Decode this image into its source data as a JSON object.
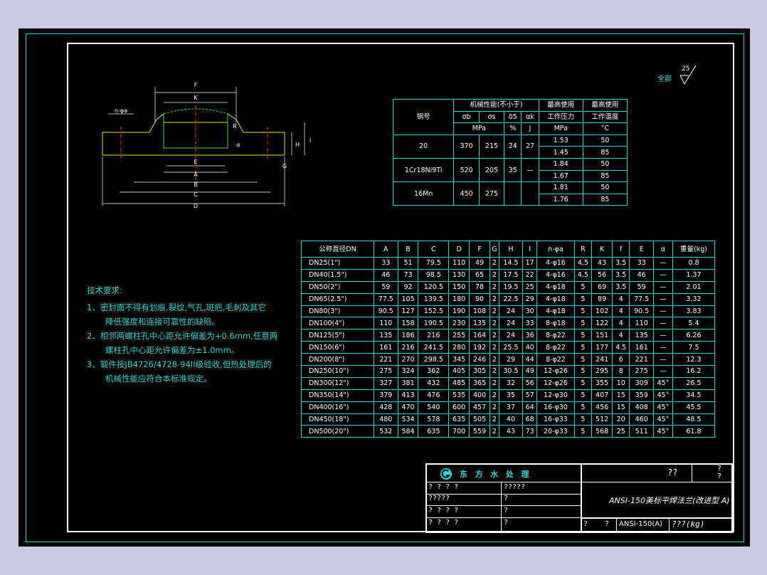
{
  "roughness": {
    "label": "全部",
    "value": "25"
  },
  "mech_table": {
    "header": {
      "grade": "钢号",
      "mech_props": "机械性能(不小于)",
      "sb": "σb",
      "ss": "σs",
      "d5": "δ5",
      "ak": "αk",
      "unit_mpa": "MPa",
      "unit_pct": "%",
      "unit_j": "J",
      "max_pressure": [
        "最高使用",
        "工作压力",
        "MPa"
      ],
      "max_temp": [
        "最高使用",
        "工作温度",
        "°C"
      ]
    },
    "rows": [
      {
        "grade": "20",
        "sb": "370",
        "ss": "215",
        "d5": "24",
        "ak": "27",
        "p1": "1.53",
        "t1": "50",
        "p2": "1.45",
        "t2": "85"
      },
      {
        "grade": "1Cr18Ni9Ti",
        "sb": "520",
        "ss": "205",
        "d5": "35",
        "ak": "—",
        "p1": "1.84",
        "t1": "50",
        "p2": "1.67",
        "t2": "85"
      },
      {
        "grade": "16Mn",
        "sb": "450",
        "ss": "275",
        "d5": "",
        "ak": "",
        "p1": "1.81",
        "t1": "50",
        "p2": "1.76",
        "t2": "85"
      }
    ]
  },
  "dim_table": {
    "headers": [
      "公称直径DN",
      "A",
      "B",
      "C",
      "D",
      "F",
      "G",
      "H",
      "I",
      "n-φa",
      "R",
      "K",
      "f",
      "E",
      "α",
      "重量(kg)"
    ],
    "rows": [
      [
        "DN25(1\")",
        "33",
        "51",
        "79.5",
        "110",
        "49",
        "2",
        "14.5",
        "17",
        "4-φ16",
        "4.5",
        "43",
        "3.5",
        "33",
        "—",
        "0.8"
      ],
      [
        "DN40(1.5\")",
        "46",
        "73",
        "98.5",
        "130",
        "65",
        "2",
        "17.5",
        "22",
        "4-φ16",
        "4.5",
        "56",
        "3.5",
        "46",
        "—",
        "1.37"
      ],
      [
        "DN50(2\")",
        "59",
        "92",
        "120.5",
        "150",
        "78",
        "2",
        "19.5",
        "25",
        "4-φ18",
        "5",
        "69",
        "3.5",
        "59",
        "—",
        "2.01"
      ],
      [
        "DN65(2.5\")",
        "77.5",
        "105",
        "139.5",
        "180",
        "90",
        "2",
        "22.5",
        "29",
        "4-φ18",
        "5",
        "89",
        "4",
        "77.5",
        "—",
        "3.32"
      ],
      [
        "DN80(3\")",
        "90.5",
        "127",
        "152.5",
        "190",
        "108",
        "2",
        "24",
        "30",
        "4-φ18",
        "5",
        "102",
        "4",
        "90.5",
        "—",
        "3.83"
      ],
      [
        "DN100(4\")",
        "110",
        "158",
        "190.5",
        "230",
        "135",
        "2",
        "24",
        "33",
        "8-φ18",
        "5",
        "122",
        "4",
        "110",
        "—",
        "5.4"
      ],
      [
        "DN125(5\")",
        "135",
        "186",
        "216",
        "255",
        "164",
        "2",
        "24",
        "36",
        "8-φ22",
        "5",
        "151",
        "4",
        "135",
        "—",
        "6.26"
      ],
      [
        "DN150(6\")",
        "161",
        "216",
        "241.5",
        "280",
        "192",
        "2",
        "25.5",
        "40",
        "8-φ22",
        "5",
        "177",
        "4.5",
        "161",
        "—",
        "7.5"
      ],
      [
        "DN200(8\")",
        "221",
        "270",
        "298.5",
        "345",
        "246",
        "2",
        "29",
        "44",
        "8-φ22",
        "5",
        "241",
        "6",
        "221",
        "—",
        "12.3"
      ],
      [
        "DN250(10\")",
        "275",
        "324",
        "362",
        "405",
        "305",
        "2",
        "30.5",
        "49",
        "12-φ26",
        "5",
        "295",
        "8",
        "275",
        "—",
        "16.2"
      ],
      [
        "DN300(12\")",
        "327",
        "381",
        "432",
        "485",
        "365",
        "2",
        "32",
        "56",
        "12-φ26",
        "5",
        "355",
        "10",
        "309",
        "45°",
        "26.5"
      ],
      [
        "DN350(14\")",
        "379",
        "413",
        "476",
        "535",
        "400",
        "2",
        "35",
        "57",
        "12-φ30",
        "5",
        "407",
        "15",
        "359",
        "45°",
        "34.5"
      ],
      [
        "DN400(16\")",
        "428",
        "470",
        "540",
        "600",
        "457",
        "2",
        "37",
        "64",
        "16-φ30",
        "5",
        "456",
        "15",
        "408",
        "45°",
        "45.5"
      ],
      [
        "DN450(18\")",
        "480",
        "534",
        "578",
        "635",
        "505",
        "2",
        "40",
        "68",
        "16-φ33",
        "5",
        "512",
        "20",
        "460",
        "45°",
        "48.5"
      ],
      [
        "DN500(20\")",
        "532",
        "584",
        "635",
        "700",
        "559",
        "2",
        "43",
        "73",
        "20-φ33",
        "5",
        "568",
        "25",
        "511",
        "45°",
        "61.8"
      ]
    ]
  },
  "notes": {
    "title": "技术要求:",
    "lines": [
      "1、密封面不得有划痕,裂纹,气孔,斑疤,毛刺及其它",
      "降低强度和连接可靠性的缺陷。",
      "2、相邻两螺柱孔中心距允许偏差为+0.6mm,任意两",
      "螺柱孔中心距允许偏差为±1.0mm。",
      "3、锻件按JB4726/4728-94II级验收,但热处理后的",
      "机械性能应符合本标准规定。"
    ]
  },
  "title_block": {
    "company": "东 方 水 处 理",
    "q_top": "??",
    "q_corner": [
      "?",
      "?"
    ],
    "rows_left": [
      "? ? ? ?",
      "?????",
      "? ? ? ?",
      "? ? ? ?"
    ],
    "rows_mid": [
      "?????",
      "?",
      "?",
      "?"
    ],
    "name": "ANSI-150美标平焊法兰(改进型 A)",
    "q_bottom": [
      "?",
      "?"
    ],
    "code": "ANSI-150(A)",
    "weight": "???(kg)"
  },
  "drawing_labels": {
    "F": "F",
    "K": "K",
    "E": "E",
    "A": "A",
    "B": "B",
    "C": "C",
    "D": "D",
    "H": "H",
    "I": "I",
    "G": "G",
    "n": "n-φa",
    "R": "R",
    "a": "α"
  }
}
